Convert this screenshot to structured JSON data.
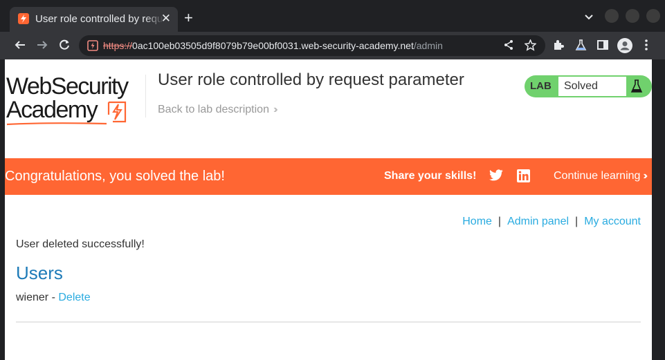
{
  "browser": {
    "tab_title": "User role controlled by request parameter",
    "url_scheme": "https://",
    "url_host": "0ac100eb03505d9f8079b79e00bf0031.web-security-academy.net",
    "url_path": "/admin"
  },
  "header": {
    "logo_line1": "WebSecurity",
    "logo_line2": "Academy",
    "title": "User role controlled by request parameter",
    "back_link": "Back to lab description",
    "lab_badge": "LAB",
    "lab_status": "Solved"
  },
  "banner": {
    "message": "Congratulations, you solved the lab!",
    "share": "Share your skills!",
    "continue": "Continue learning"
  },
  "nav": {
    "home": "Home",
    "sep1": "|",
    "admin": "Admin panel",
    "sep2": "|",
    "account": "My account"
  },
  "main": {
    "message": "User deleted successfully!",
    "heading": "Users",
    "users": [
      {
        "name": "wiener",
        "separator": " - ",
        "action": "Delete"
      }
    ]
  },
  "colors": {
    "accent": "#ff6633",
    "solved": "#70d16d",
    "link": "#29abe0",
    "heading": "#1e7bb8"
  }
}
